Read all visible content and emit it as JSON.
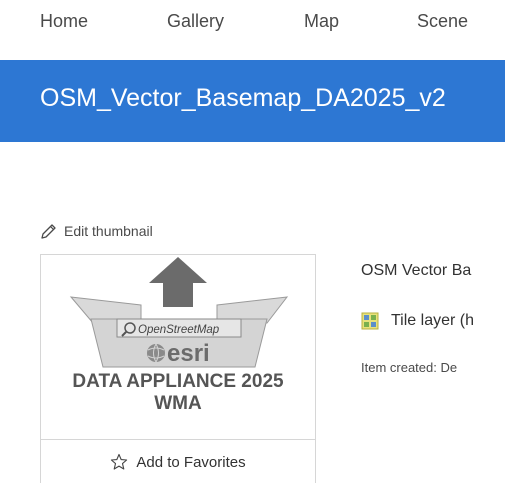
{
  "nav": {
    "items": [
      {
        "label": "Home"
      },
      {
        "label": "Gallery"
      },
      {
        "label": "Map"
      },
      {
        "label": "Scene"
      }
    ]
  },
  "banner": {
    "title": "OSM_Vector_Basemap_DA2025_v2",
    "color": "#2d77d3"
  },
  "thumbnail": {
    "edit_label": "Edit thumbnail",
    "logo_text_osm": "OpenStreetMap",
    "logo_text_esri": "esri",
    "caption_line1": "DATA APPLIANCE 2025",
    "caption_line2": "WMA",
    "favorites_label": "Add to Favorites"
  },
  "item": {
    "title": "OSM Vector Ba",
    "type_icon": "tile-layer-icon",
    "type_label": "Tile layer (h",
    "created": "Item created: De"
  }
}
